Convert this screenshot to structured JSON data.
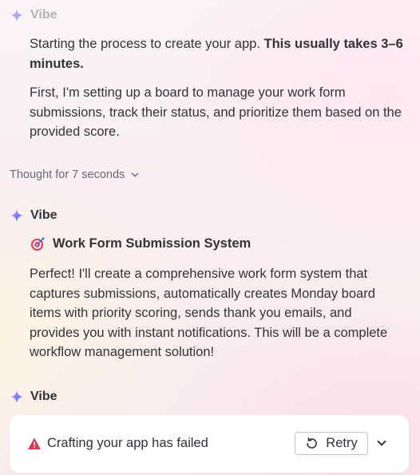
{
  "messages": [
    {
      "agent": "Vibe",
      "intro": "Starting the process to create your app. ",
      "intro_bold": "This usually takes 3–6 minutes.",
      "body": "First, I'm setting up a board to manage your work form submissions, track their status, and prioritize them based on the provided score."
    },
    {
      "agent": "Vibe",
      "title_icon": "target-icon",
      "title": "Work Form Submission System",
      "body": "Perfect! I'll create a comprehensive work form system that captures submissions, automatically creates Monday board items with priority scoring, sends thank you emails, and provides you with instant notifications. This will be a complete workflow management solution!"
    },
    {
      "agent": "Vibe"
    }
  ],
  "thought": {
    "label": "Thought for 7 seconds",
    "icon": "chevron-down-icon"
  },
  "failure": {
    "icon": "warning-icon",
    "text": "Crafting your app has failed",
    "retry_label": "Retry",
    "retry_icon": "refresh-icon",
    "expand_icon": "chevron-down-icon"
  },
  "colors": {
    "spark_blue": "#4a7bf7",
    "spark_pink": "#f4729c",
    "spark_yellow": "#ffcb00",
    "spark_green": "#22c38e",
    "error_red": "#d83a52",
    "text": "#323338",
    "muted": "#676879"
  }
}
